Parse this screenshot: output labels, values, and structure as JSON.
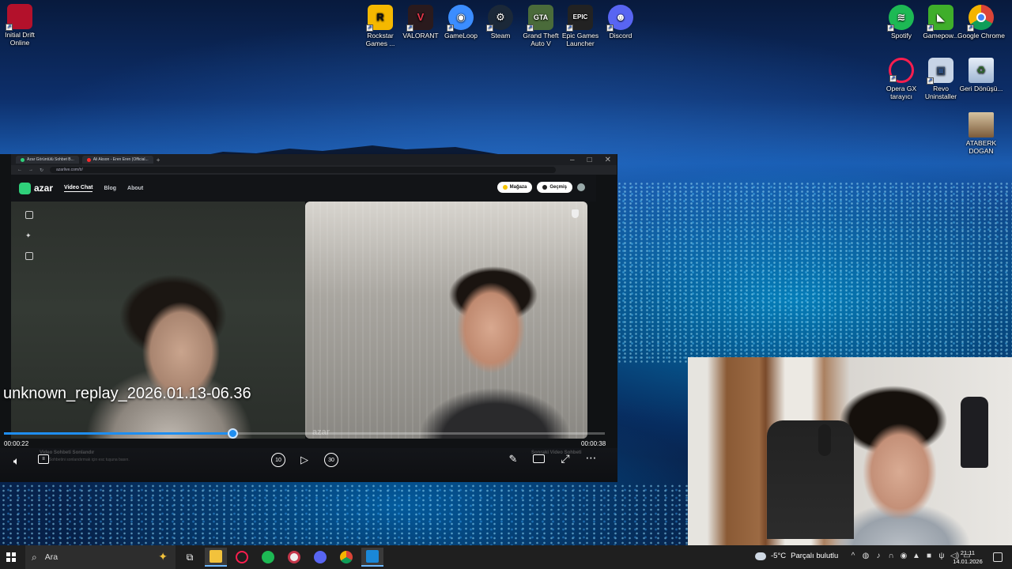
{
  "desktop": {
    "icons": [
      {
        "label": "Initial Drift Online",
        "icon": "initial-drift-icon",
        "color": "#b3112b"
      },
      {
        "label": "Rockstar Games ...",
        "icon": "rockstar-icon",
        "color": "#f5b800"
      },
      {
        "label": "VALORANT",
        "icon": "valorant-icon",
        "color": "#e8364a"
      },
      {
        "label": "GameLoop",
        "icon": "gameloop-icon",
        "color": "#3b8dff"
      },
      {
        "label": "Steam",
        "icon": "steam-icon",
        "color": "#1b2838"
      },
      {
        "label": "Grand Theft Auto V",
        "icon": "gta-icon",
        "color": "#4a6b3a"
      },
      {
        "label": "Epic Games Launcher",
        "icon": "epic-games-icon",
        "color": "#222222"
      },
      {
        "label": "Discord",
        "icon": "discord-icon",
        "color": "#5865f2"
      },
      {
        "label": "Spotify",
        "icon": "spotify-icon",
        "color": "#1db954"
      },
      {
        "label": "Gamepow...",
        "icon": "gamepower-icon",
        "color": "#3fae2a"
      },
      {
        "label": "Google Chrome",
        "icon": "chrome-icon",
        "color": "#db4437"
      },
      {
        "label": "Opera GX tarayıcı",
        "icon": "opera-gx-icon",
        "color": "#fa1e4e"
      },
      {
        "label": "Revo Uninstaller",
        "icon": "revo-icon",
        "color": "#c7d4e6"
      },
      {
        "label": "Geri Dönüşü...",
        "icon": "recycle-bin-icon",
        "color": "#8fb0d6"
      },
      {
        "label": "ATABERK DOGAN",
        "icon": "user-folder-icon",
        "color": "#d6c3a0"
      }
    ]
  },
  "player": {
    "title": "unknown_replay_2026.01.13-06.36",
    "time_current": "00:00:22",
    "time_total": "00:00:38",
    "progress": 0.38,
    "accent": "#1f8ef0",
    "skip_back_label": "10",
    "skip_forward_label": "30",
    "icons": {
      "volume": "volume-icon",
      "captions": "captions-icon",
      "play": "play-icon",
      "edit": "pen-icon",
      "miniplayer": "miniplayer-icon",
      "fullscreen": "fullscreen-icon",
      "more": "more-icon"
    }
  },
  "captured_browser": {
    "tabs": [
      "Azar Görüntülü Sohbet B...",
      "Ali Akson - Eren Eren (Official..."
    ],
    "url": "azarlive.com/tr/",
    "nav": {
      "logo": "azar",
      "video_chat": "Video Chat",
      "blog": "Blog",
      "about": "About"
    },
    "buttons": {
      "store": "Mağaza",
      "history": "Geçmiş"
    },
    "watermark": "azar",
    "ghost_left_title": "Video Sohbeti Sonlandır",
    "ghost_left_sub": "Sohbetini sonlandırmak için esc tuşuna basın.",
    "ghost_right_title": "Sonraki Video Sohbeti"
  },
  "taskbar": {
    "search_placeholder": "Ara",
    "weather_temp": "-5°C",
    "weather_desc": "Parçalı bulutlu",
    "time": "21:11",
    "date": "14.01.2026",
    "apps": [
      "task-view-icon",
      "file-explorer-icon",
      "opera-gx-icon",
      "spotify-icon",
      "steam-icon",
      "discord-icon",
      "chrome-icon",
      "media-player-icon"
    ]
  }
}
